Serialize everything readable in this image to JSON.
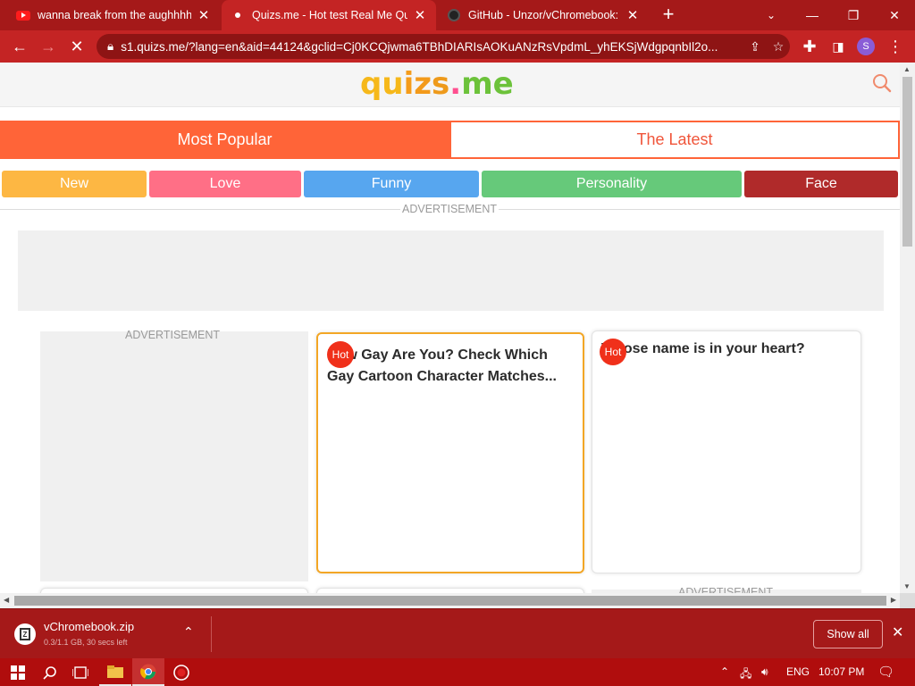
{
  "browser": {
    "tabs": [
      {
        "title": "wanna break from the aughhhh -",
        "favicon": "youtube-icon",
        "active": false
      },
      {
        "title": "Quizs.me - Hot test Real Me Quiz",
        "favicon": "quizsme-icon",
        "active": true
      },
      {
        "title": "GitHub - Unzor/vChromebook: C",
        "favicon": "github-icon",
        "active": false
      }
    ],
    "url": "s1.quizs.me/?lang=en&aid=44124&gclid=Cj0KCQjwma6TBhDIARIsAOKuANzRsVpdmL_yhEKSjWdgpqnbIl2o...",
    "profile_initial": "S",
    "window_controls": {
      "minimize": "—",
      "restore": "❐",
      "close": "✕"
    }
  },
  "site": {
    "logo": {
      "q": "q",
      "u": "u",
      "i": "i",
      "z": "z",
      "s": "s",
      "dot": ".",
      "me": "me"
    },
    "main_tabs": {
      "popular": "Most Popular",
      "latest": "The Latest"
    },
    "categories": [
      {
        "label": "New",
        "color": "#fdb743"
      },
      {
        "label": "Love",
        "color": "#ff6f86"
      },
      {
        "label": "Funny",
        "color": "#57a6ef"
      },
      {
        "label": "Personality",
        "color": "#66c97a"
      },
      {
        "label": "Face",
        "color": "#b02a2a"
      }
    ],
    "ad_label": "ADVERTISEMENT",
    "hot_badge": "Hot",
    "cards": [
      {
        "title": "How Gay Are You? Check Which Gay Cartoon Character Matches...",
        "hot": true,
        "selected": true
      },
      {
        "title": "Whose name is in your heart?",
        "hot": true,
        "selected": false
      }
    ]
  },
  "download": {
    "filename": "vChromebook.zip",
    "status": "0.3/1.1 GB, 30 secs left",
    "show_all": "Show all"
  },
  "taskbar": {
    "language": "ENG",
    "time": "10:07 PM"
  },
  "colors": {
    "chrome_frame": "#a51919",
    "chrome_active": "#c42424",
    "site_accent": "#ff6438",
    "hot_badge": "#f0301a",
    "selected_card_border": "#f3a625"
  }
}
